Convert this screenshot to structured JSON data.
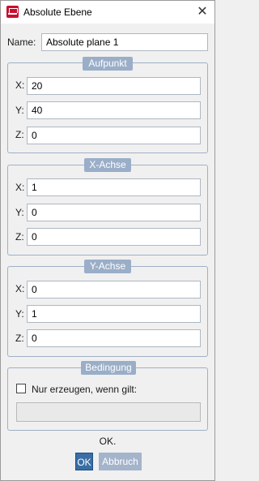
{
  "window": {
    "title": "Absolute Ebene",
    "close_glyph": "✕"
  },
  "name": {
    "label": "Name:",
    "value": "Absolute plane 1"
  },
  "aufpunkt": {
    "legend": "Aufpunkt",
    "x_label": "X:",
    "x_value": "20",
    "y_label": "Y:",
    "y_value": "40",
    "z_label": "Z:",
    "z_value": "0"
  },
  "x_achse": {
    "legend": "X-Achse",
    "x_label": "X:",
    "x_value": "1",
    "y_label": "Y:",
    "y_value": "0",
    "z_label": "Z:",
    "z_value": "0"
  },
  "y_achse": {
    "legend": "Y-Achse",
    "x_label": "X:",
    "x_value": "0",
    "y_label": "Y:",
    "y_value": "1",
    "z_label": "Z:",
    "z_value": "0"
  },
  "bedingung": {
    "legend": "Bedingung",
    "checkbox_label": "Nur erzeugen, wenn gilt:",
    "checked": false,
    "condition_value": ""
  },
  "footer": {
    "status": "OK.",
    "ok_label": "OK",
    "cancel_label": "Abbruch"
  }
}
